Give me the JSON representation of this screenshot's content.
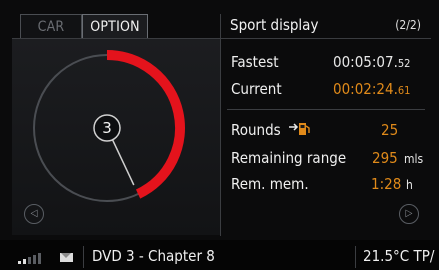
{
  "tabs": [
    {
      "label": "CAR",
      "active": false
    },
    {
      "label": "OPTION",
      "active": true
    }
  ],
  "header": {
    "title": "Sport display",
    "page": "(2/2)"
  },
  "gauge": {
    "lap_number": "3",
    "progress_fraction": 0.43,
    "accent_color": "#e4131c"
  },
  "stats": {
    "fastest_label": "Fastest",
    "fastest_main": "00:05:07.",
    "fastest_frac": "52",
    "current_label": "Current",
    "current_main": "00:02:24.",
    "current_frac": "61",
    "rounds_label": "Rounds",
    "rounds_value": "25",
    "remaining_label": "Remaining range",
    "remaining_value": "295",
    "remaining_unit": "mls",
    "remmem_label": "Rem. mem.",
    "remmem_value": "1:28",
    "remmem_unit": "h"
  },
  "statusbar": {
    "media": "DVD 3 - Chapter 8",
    "temperature": "21.5°C TP/"
  },
  "colors": {
    "orange": "#e08a1a",
    "red": "#e4131c"
  }
}
